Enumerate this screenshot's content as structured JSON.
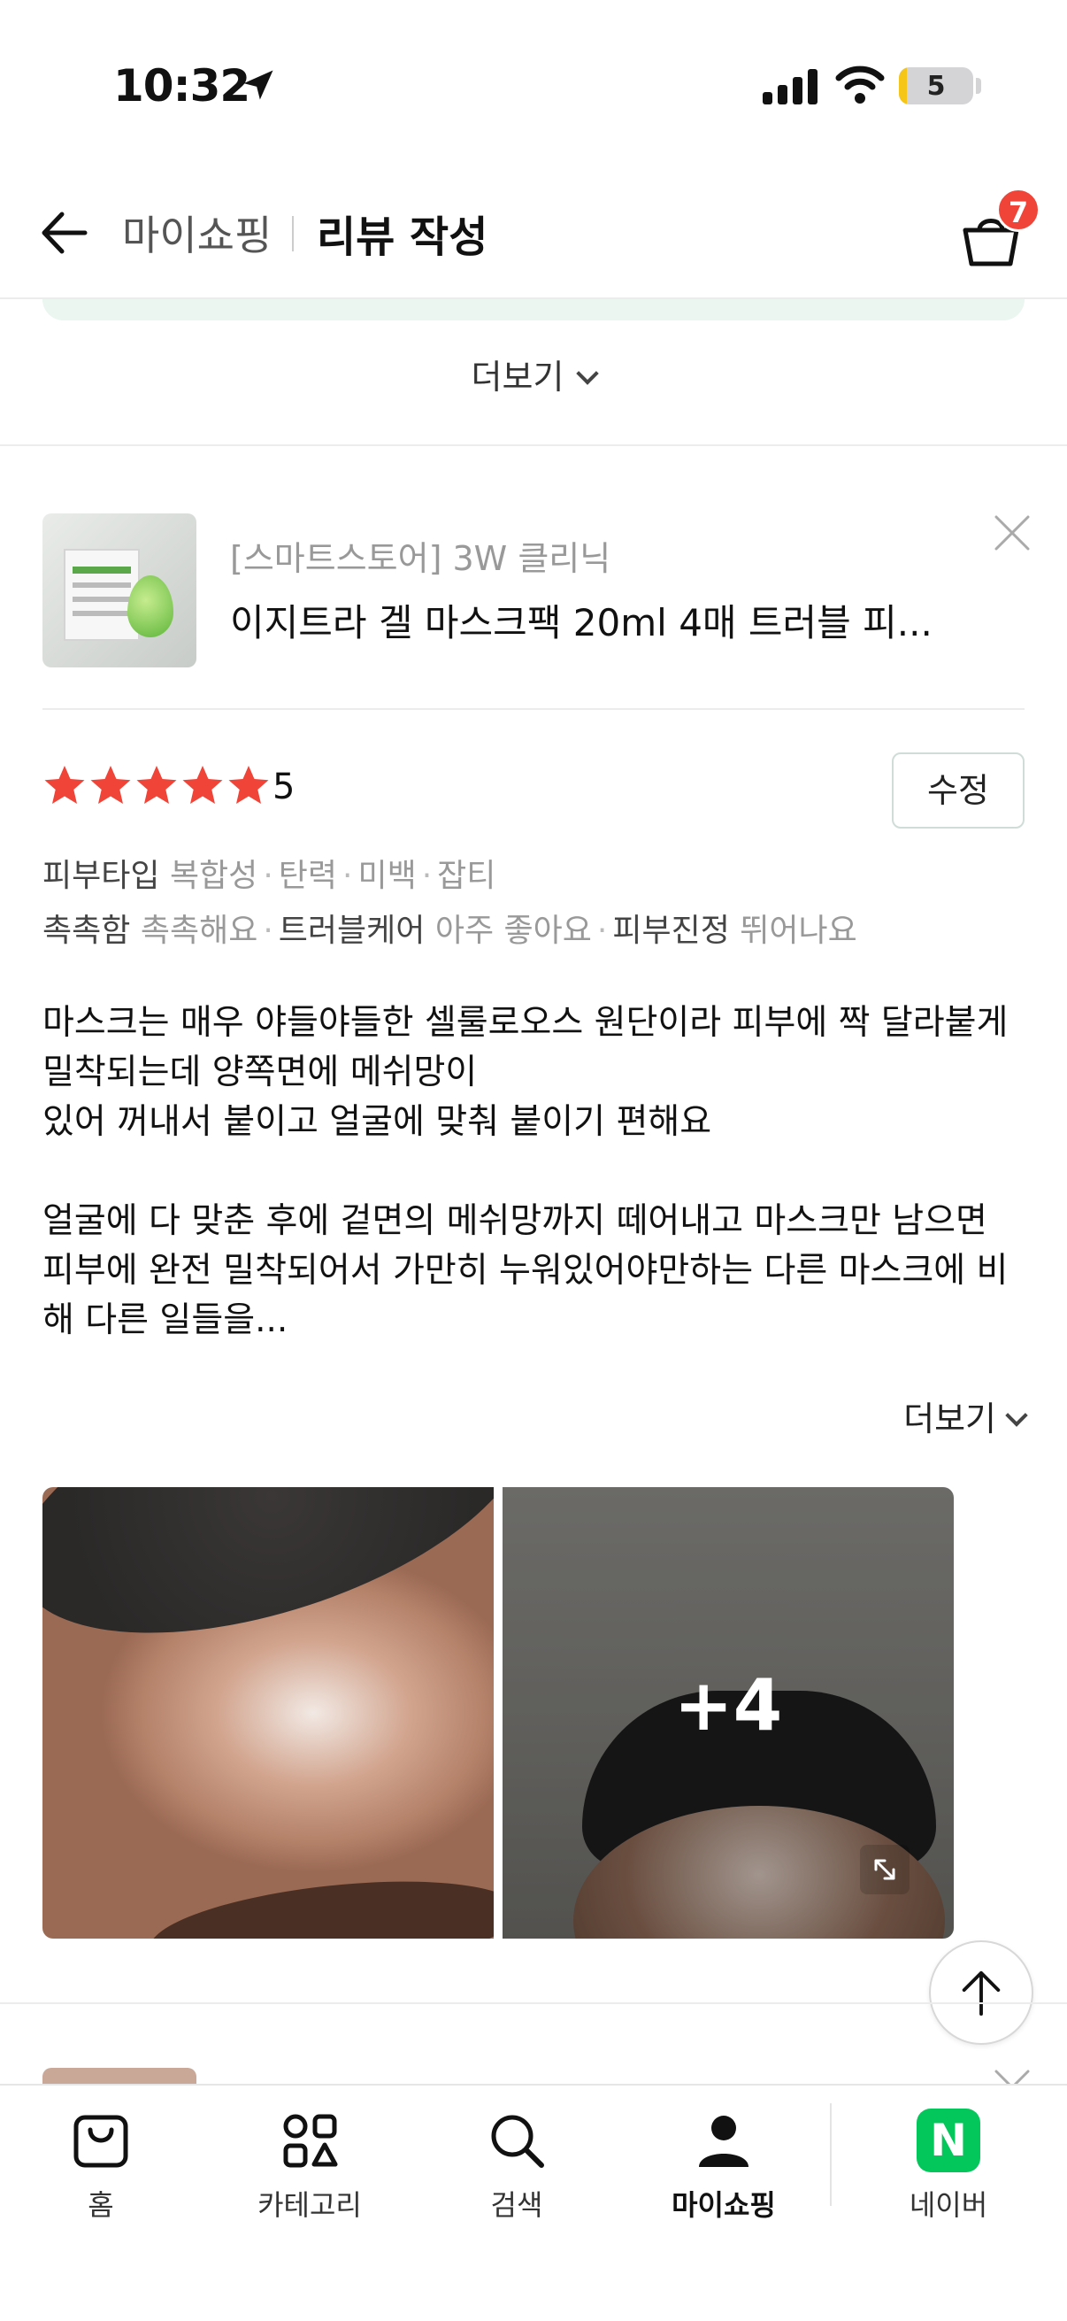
{
  "status_bar": {
    "time": "10:32",
    "battery": "5"
  },
  "header": {
    "shop_label": "마이쇼핑",
    "title": "리뷰 작성",
    "cart_count": "7"
  },
  "top_more_label": "더보기",
  "product": {
    "store": "[스마트스토어] 3W 클리닉",
    "name": "이지트라 겔 마스크팩 20ml 4매 트러블 피..."
  },
  "review": {
    "rating": 5,
    "rating_label": "5",
    "edit_label": "수정",
    "skin_type_key": "피부타입",
    "skin_types": [
      "복합성",
      "탄력",
      "미백",
      "잡티"
    ],
    "evaluations": [
      {
        "key": "촉촉함",
        "value": "촉촉해요"
      },
      {
        "key": "트러블케어",
        "value": "아주 좋아요"
      },
      {
        "key": "피부진정",
        "value": "뛰어나요"
      }
    ],
    "text": "마스크는 매우 야들야들한 셀룰로오스 원단이라 피부에 짝 달라붙게 밀착되는데 양쪽면에 메쉬망이\n있어 꺼내서 붙이고 얼굴에 맞춰 붙이기 편해요\n\n얼굴에 다 맞춘 후에 겉면의 메쉬망까지 떼어내고 마스크만 남으면 피부에 완전 밀착되어서 가만히 누워있어야만하는 다른 마스크에 비해 다른 일들을...",
    "more_label": "더보기",
    "photo_more_count": "+4"
  },
  "bottom_nav": [
    {
      "label": "홈",
      "icon": "home-bag-icon"
    },
    {
      "label": "카테고리",
      "icon": "category-icon"
    },
    {
      "label": "검색",
      "icon": "search-icon"
    },
    {
      "label": "마이쇼핑",
      "icon": "person-icon",
      "active": true
    },
    {
      "label": "네이버",
      "icon": "naver-logo-icon"
    }
  ],
  "colors": {
    "star": "#f04438",
    "badge": "#f04438",
    "naver_green": "#03c75a"
  }
}
